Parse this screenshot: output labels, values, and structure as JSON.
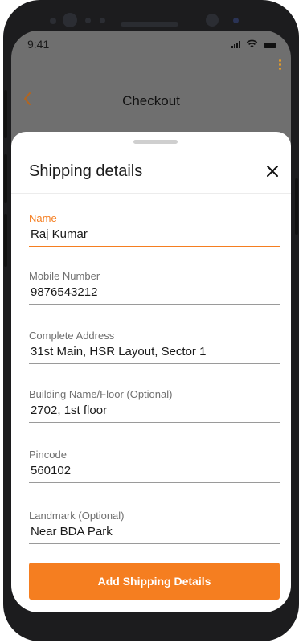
{
  "status_bar": {
    "time": "9:41"
  },
  "background": {
    "title": "Checkout"
  },
  "sheet": {
    "title": "Shipping details",
    "fields": [
      {
        "label": "Name",
        "value": "Raj Kumar"
      },
      {
        "label": "Mobile Number",
        "value": "9876543212"
      },
      {
        "label": "Complete Address",
        "value": "31st Main, HSR Layout, Sector 1"
      },
      {
        "label": "Building Name/Floor (Optional)",
        "value": "2702, 1st floor"
      },
      {
        "label": "Pincode",
        "value": "560102"
      },
      {
        "label": "Landmark (Optional)",
        "value": "Near BDA Park"
      }
    ],
    "submit_label": "Add Shipping Details"
  },
  "colors": {
    "accent": "#f57e20",
    "backdrop": "#6f6f6f",
    "sheet_bg": "#ffffff",
    "text": "#1a1a1a"
  },
  "icons": [
    "signal-icon",
    "wifi-icon",
    "battery-icon",
    "kebab-menu-icon",
    "back-icon",
    "close-icon"
  ]
}
